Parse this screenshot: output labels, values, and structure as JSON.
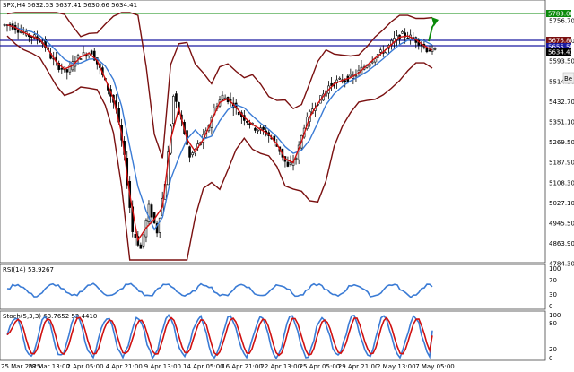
{
  "header": {
    "symbol_line": "SPX,H4  5632.53 5637.41 5630.66 5634.41",
    "rsi_label": "RSI(14) 53.9267",
    "stoch_label": "Stoch(5,3,3) 63.7652 52.4410"
  },
  "badges": {
    "upper_green": "5783.00",
    "blue_upper": "5676.88",
    "blue_lower": "5655.50",
    "current": "5634.41"
  },
  "price_axis": [
    "5756.70",
    "5675.20",
    "5593.50",
    "5514.30",
    "5432.70",
    "5351.10",
    "5269.50",
    "5187.90",
    "5108.30",
    "5027.10",
    "4945.50",
    "4863.90",
    "4784.30"
  ],
  "rsi_axis": [
    "100",
    "70",
    "30",
    "0"
  ],
  "stoch_axis": [
    "100",
    "80",
    "20",
    "0"
  ],
  "time_axis": [
    "25 Mar 2025",
    "28 Mar 13:00",
    "2 Apr 05:00",
    "4 Apr 21:00",
    "9 Apr 13:00",
    "14 Apr 05:00",
    "16 Apr 21:00",
    "22 Apr 13:00",
    "25 Apr 05:00",
    "29 Apr 21:00",
    "2 May 13:00",
    "7 May 05:00"
  ],
  "tooltip": "Be",
  "colors": {
    "bollinger": "#7a1010",
    "ma_red": "#d01010",
    "ma_blue": "#3a7bd5",
    "green": "#0a8a0a",
    "navy": "#1a1aa0",
    "candle": "#000000"
  },
  "chart_data": {
    "type": "line",
    "ylim": [
      4784.3,
      5790
    ],
    "series": [
      {
        "name": "",
        "values": [
          5740,
          5720,
          5700,
          5690,
          5670,
          5610,
          5570,
          5550,
          5600,
          5620,
          5630,
          5560,
          5480,
          5400,
          5200,
          4900,
          4830,
          5000,
          4900,
          5100,
          5450,
          5350,
          5200,
          5250,
          5300,
          5400,
          5450,
          5430,
          5380,
          5350,
          5320,
          5310,
          5280,
          5230,
          5160,
          5200,
          5330,
          5400,
          5440,
          5490,
          5510,
          5520,
          5530,
          5560,
          5590,
          5620,
          5640,
          5680,
          5700,
          5690,
          5670,
          5640,
          5634
        ]
      }
    ]
  }
}
